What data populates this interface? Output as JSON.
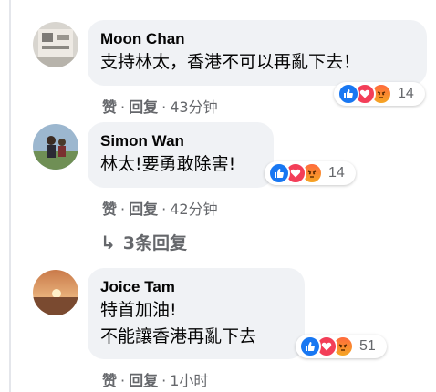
{
  "comments": [
    {
      "author": "Moon Chan",
      "lines": [
        "支持林太，香港不可以再亂下去！"
      ],
      "reaction_count": "14",
      "like_label": "赞",
      "reply_label": "回复",
      "separator": "·",
      "time": "43分钟"
    },
    {
      "author": "Simon Wan",
      "lines": [
        "林太!要勇敢除害!"
      ],
      "reaction_count": "14",
      "like_label": "赞",
      "reply_label": "回复",
      "separator": "·",
      "time": "42分钟",
      "replies_link": "3条回复"
    },
    {
      "author": "Joice Tam",
      "lines": [
        "特首加油!",
        "不能讓香港再亂下去"
      ],
      "reaction_count": "51",
      "like_label": "赞",
      "reply_label": "回复",
      "separator": "·",
      "time": "1小时"
    }
  ],
  "icons": {
    "replies_arrow": "reply-arrow-icon",
    "like": "like-reaction-icon",
    "love": "love-reaction-icon",
    "angry": "angry-reaction-icon"
  },
  "colors": {
    "bubble": "#f0f2f5",
    "meta_text": "#65676b",
    "like_blue": "#1877f2",
    "love_red": "#f33e58"
  }
}
